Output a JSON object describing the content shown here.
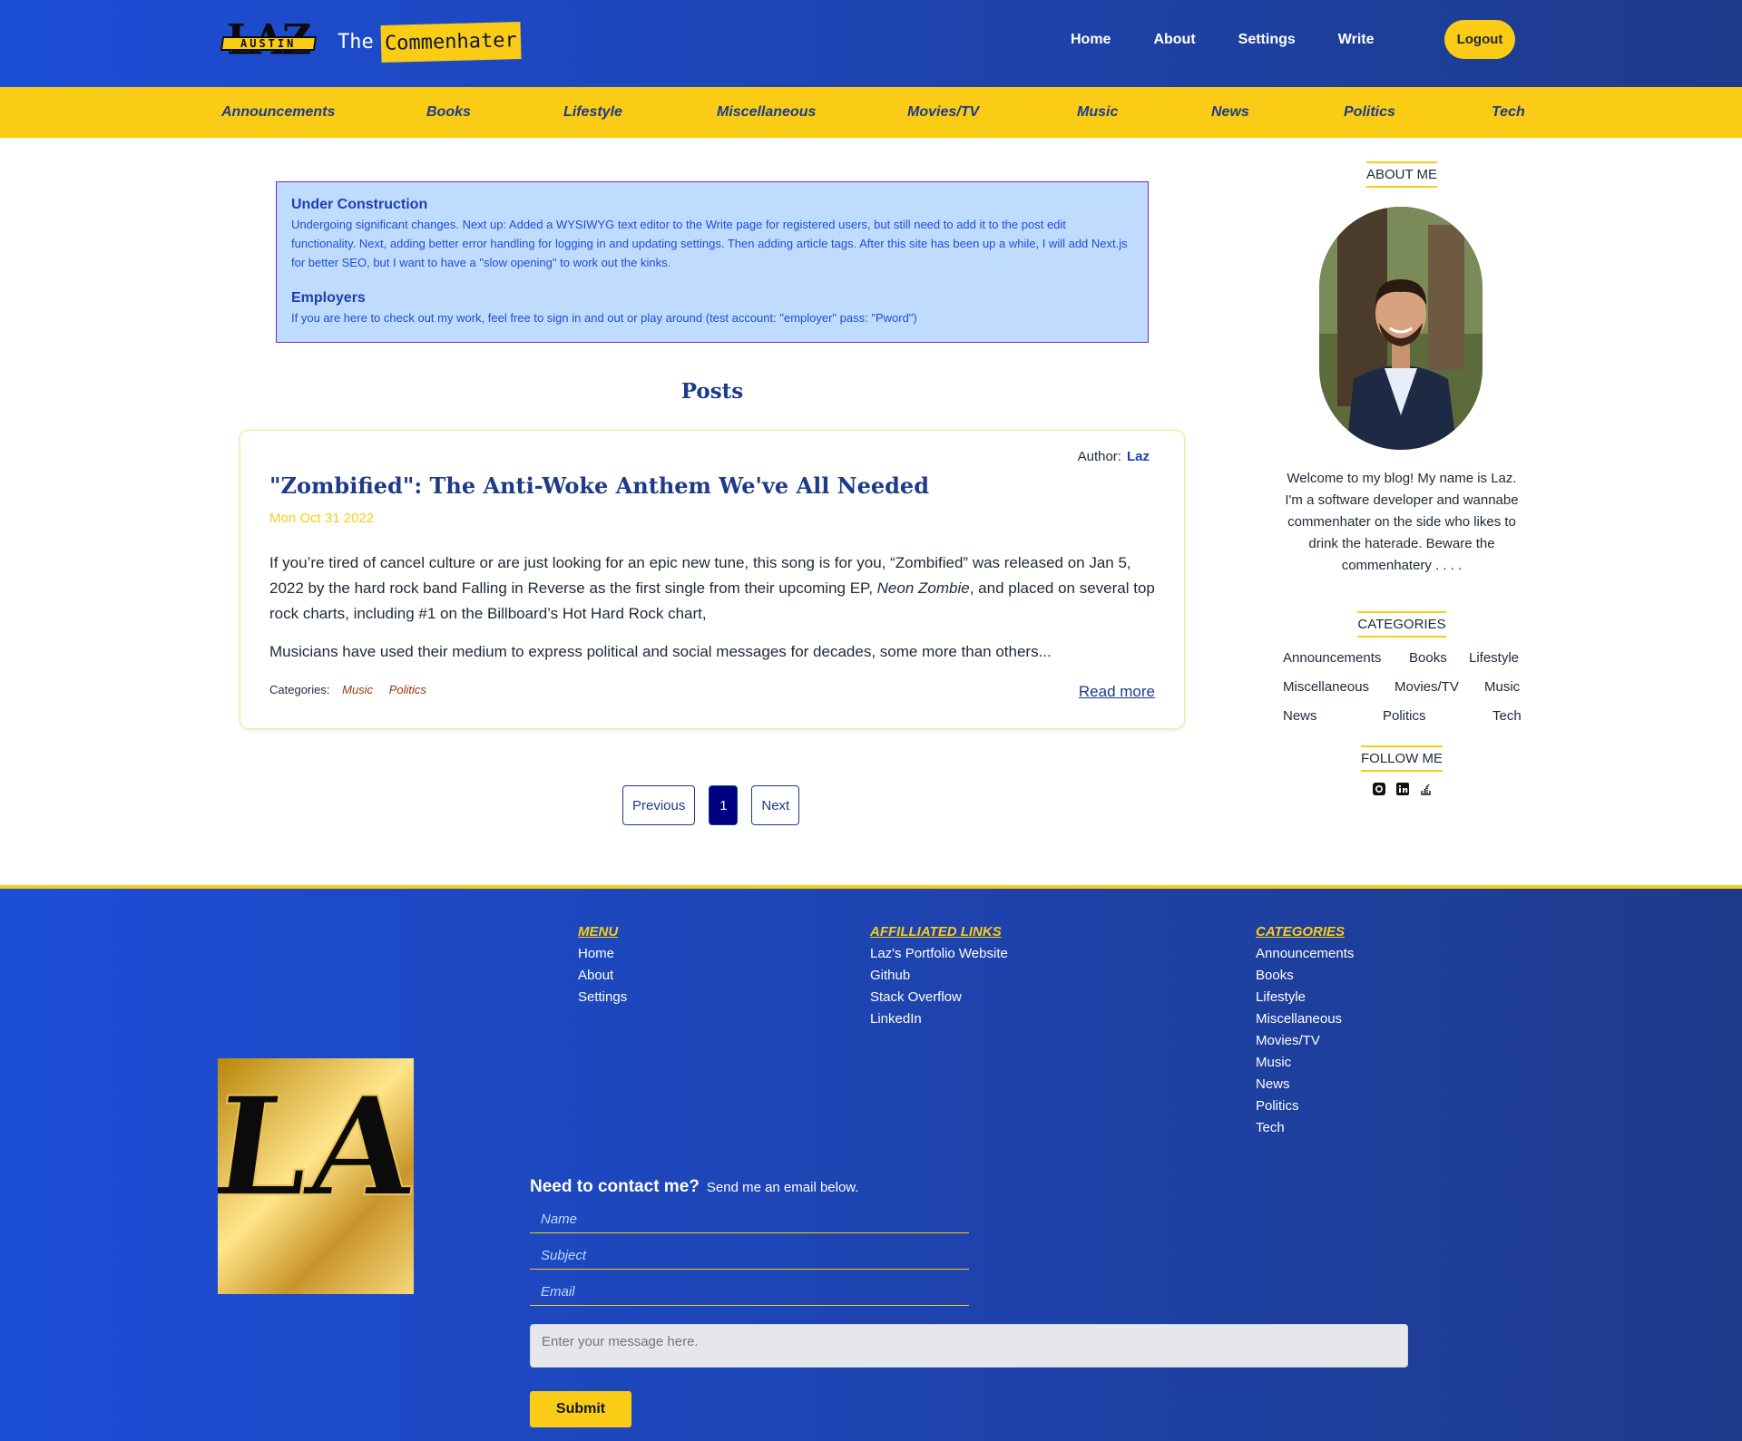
{
  "header": {
    "logo_big": "LAZ",
    "logo_ribbon": "AUSTIN",
    "title_the": "The",
    "title_name": "Commenhater",
    "nav": [
      "Home",
      "About",
      "Settings",
      "Write"
    ],
    "logout": "Logout"
  },
  "category_bar": [
    "Announcements",
    "Books",
    "Lifestyle",
    "Miscellaneous",
    "Movies/TV",
    "Music",
    "News",
    "Politics",
    "Tech"
  ],
  "notice": {
    "title1": "Under Construction",
    "text1": "Undergoing significant changes. Next up: Added a WYSIWYG text editor to the Write page for registered users, but still need to add it to the post edit functionality. Next, adding better error handling for logging in and updating settings. Then adding article tags. After this site has been up a while, I will add Next.js for better SEO, but I want to have a \"slow opening\" to work out the kinks.",
    "title2": "Employers",
    "text2": "If you are here to check out my work, feel free to sign in and out or play around (test account: \"employer\" pass: \"Pword\")"
  },
  "posts_heading": "Posts",
  "post": {
    "author_label": "Author:",
    "author": "Laz",
    "title": "\"Zombified\": The Anti-Woke Anthem We've All Needed",
    "date": "Mon Oct 31 2022",
    "excerpt_a": "If you’re tired of cancel culture or are just looking for an epic new tune, this song is for you, “Zombified” was released on Jan 5, 2022 by the hard rock band Falling in Reverse as the first single from their upcoming EP, ",
    "excerpt_em": "Neon Zombie",
    "excerpt_b": ", and placed on several top rock charts, including #1 on the Billboard’s Hot Hard Rock chart,",
    "excerpt2": "Musicians have used their medium to express political and social messages for decades, some more than others...",
    "categories_label": "Categories:",
    "categories": [
      "Music",
      "Politics"
    ],
    "read_more": "Read more"
  },
  "pagination": {
    "previous": "Previous",
    "current": "1",
    "next": "Next"
  },
  "sidebar": {
    "about_heading": "ABOUT ME",
    "bio": "Welcome to my blog! My name is Laz. I'm a software developer and wannabe commenhater on the side who likes to drink the haterade. Beware the commenhatery . . . .",
    "categories_heading": "CATEGORIES",
    "categories": [
      "Announcements",
      "Books",
      "Lifestyle",
      "Miscellaneous",
      "Movies/TV",
      "Music",
      "News",
      "Politics",
      "Tech"
    ],
    "follow_heading": "FOLLOW ME",
    "social_icons": [
      "github-icon",
      "linkedin-icon",
      "stack-overflow-icon"
    ]
  },
  "footer": {
    "menu_heading": "MENU",
    "menu": [
      "Home",
      "About",
      "Settings"
    ],
    "links_heading": "AFFILLIATED LINKS",
    "links": [
      "Laz's Portfolio Website",
      "Github",
      "Stack Overflow",
      "LinkedIn"
    ],
    "cats_heading": "CATEGORIES",
    "cats": [
      "Announcements",
      "Books",
      "Lifestyle",
      "Miscellaneous",
      "Movies/TV",
      "Music",
      "News",
      "Politics",
      "Tech"
    ],
    "logo_text": "LAZ",
    "contact_title": "Need to contact me?",
    "contact_sub": "Send me an email below.",
    "name_placeholder": "Name",
    "subject_placeholder": "Subject",
    "email_placeholder": "Email",
    "message_placeholder": "Enter your message here.",
    "submit": "Submit"
  },
  "colors": {
    "primary": "#1d4ed8",
    "accent": "#facc15",
    "navy": "#1e3a8a"
  }
}
